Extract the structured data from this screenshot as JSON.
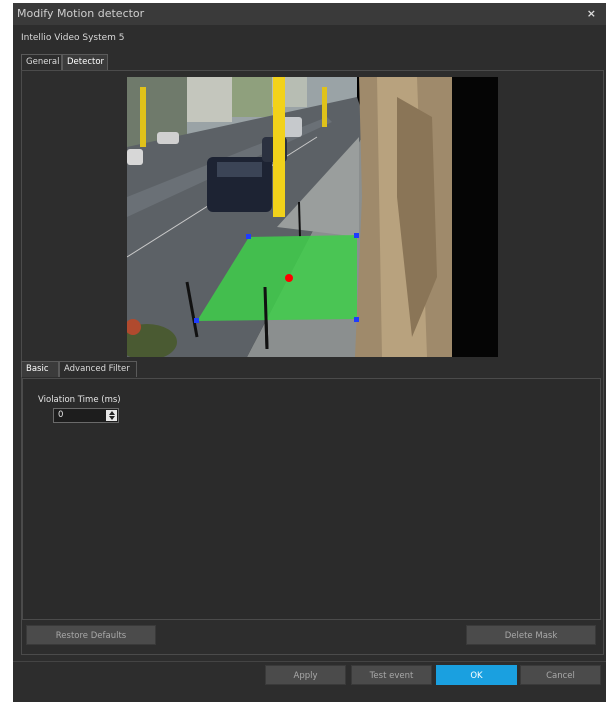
{
  "window": {
    "title": "Modify Motion detector",
    "close_glyph": "×",
    "subtitle": "Intellio Video System 5"
  },
  "tabs": [
    {
      "label": "General"
    },
    {
      "label": "Detector"
    }
  ],
  "sub_tabs": [
    {
      "label": "Basic"
    },
    {
      "label": "Advanced Filter"
    }
  ],
  "basic": {
    "violation_label": "Violation Time (ms)",
    "violation_value": "0"
  },
  "buttons": {
    "restore_defaults": "Restore Defaults",
    "delete_mask": "Delete Mask",
    "apply": "Apply",
    "test_event": "Test event",
    "ok": "OK",
    "cancel": "Cancel"
  },
  "colors": {
    "accent": "#1aa0e0",
    "mask": "#3ecf4a",
    "mask_handle": "#1e3cff",
    "center_point": "#ff0000"
  }
}
